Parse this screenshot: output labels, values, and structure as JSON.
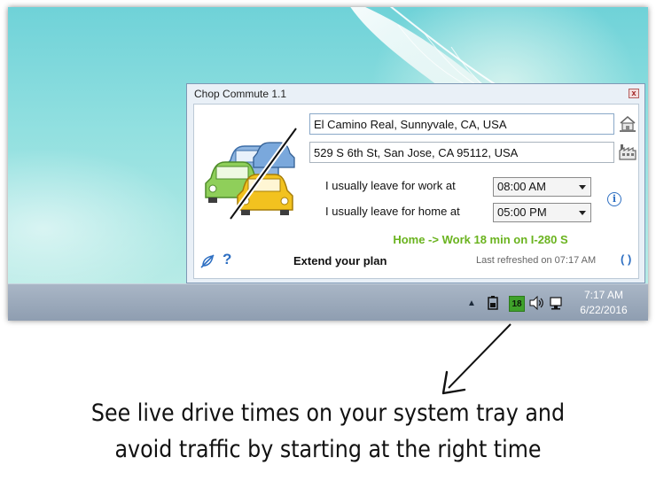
{
  "popup": {
    "title": "Chop Commute 1.1",
    "from_address": "El Camino Real, Sunnyvale, CA, USA",
    "to_address": "529 S 6th St, San Jose, CA 95112, USA",
    "leave_work_label": "I usually leave for work at",
    "leave_work_time": "08:00 AM",
    "leave_home_label": "I usually leave for home at",
    "leave_home_time": "05:00 PM",
    "commute_status": "Home -> Work 18 min on I-280 S",
    "help_label": "?",
    "extend_plan": "Extend your plan",
    "last_refreshed": "Last refreshed on 07:17 AM",
    "info_label": "i",
    "close_label": "x",
    "refresh_label": "( )",
    "icons": {
      "logo": "cars-logo-icon",
      "home": "house-icon",
      "work": "factory-icon",
      "info": "info-icon",
      "settings": "no-leaf-icon",
      "help": "question-icon",
      "refresh": "refresh-icon",
      "close": "close-icon"
    },
    "colors": {
      "status": "#6ab31e",
      "accent": "#2e6fc2"
    }
  },
  "tray": {
    "badge": "18",
    "time": "7:17 AM",
    "date": "6/22/2016",
    "up_label": "▲",
    "battery_label": "▯",
    "volume_label": "🔊",
    "network_label": "▭",
    "badge_color": "#3fa12a"
  },
  "caption": {
    "line1": "See live drive times on your system tray and",
    "line2": "avoid traffic by starting at the right time"
  }
}
